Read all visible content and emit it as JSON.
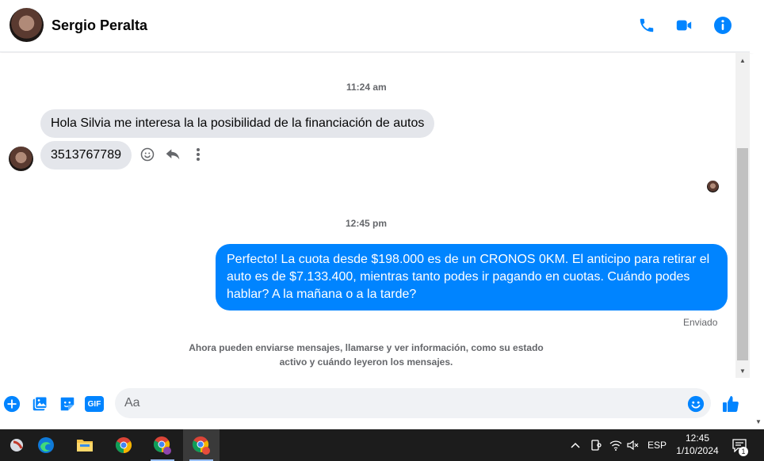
{
  "header": {
    "contact_name": "Sergio Peralta",
    "icons": [
      "phone-icon",
      "video-icon",
      "info-icon"
    ],
    "accent_color": "#0084ff"
  },
  "conversation": {
    "timestamp_1": "11:24 am",
    "incoming_messages": [
      "Hola Silvia me interesa la la posibilidad de la financiación de autos",
      "3513767789"
    ],
    "message_actions": [
      "reaction-icon",
      "reply-icon",
      "more-icon"
    ],
    "timestamp_2": "12:45 pm",
    "outgoing_message": "Perfecto! La cuota desde $198.000 es de un CRONOS 0KM. El anticipo para retirar el auto es de $7.133.400, mientras tanto podes ir pagando en cuotas. Cuándo podes hablar? A la mañana o a la tarde?",
    "sent_status": "Enviado",
    "info_notice": "Ahora pueden enviarse mensajes, llamarse y ver información, como su estado activo y cuándo leyeron los mensajes."
  },
  "composer": {
    "placeholder": "Aa",
    "icons": [
      "plus-icon",
      "gallery-icon",
      "sticker-icon",
      "gif-icon",
      "emoji-icon",
      "like-icon"
    ],
    "gif_label": "GIF"
  },
  "taskbar": {
    "apps": [
      "app-icon",
      "edge-icon",
      "file-explorer-icon",
      "chrome-icon",
      "chrome-profile-icon",
      "chrome-profile-icon-2"
    ],
    "language": "ESP",
    "time": "12:45",
    "date": "1/10/2024",
    "notification_count": "1"
  }
}
